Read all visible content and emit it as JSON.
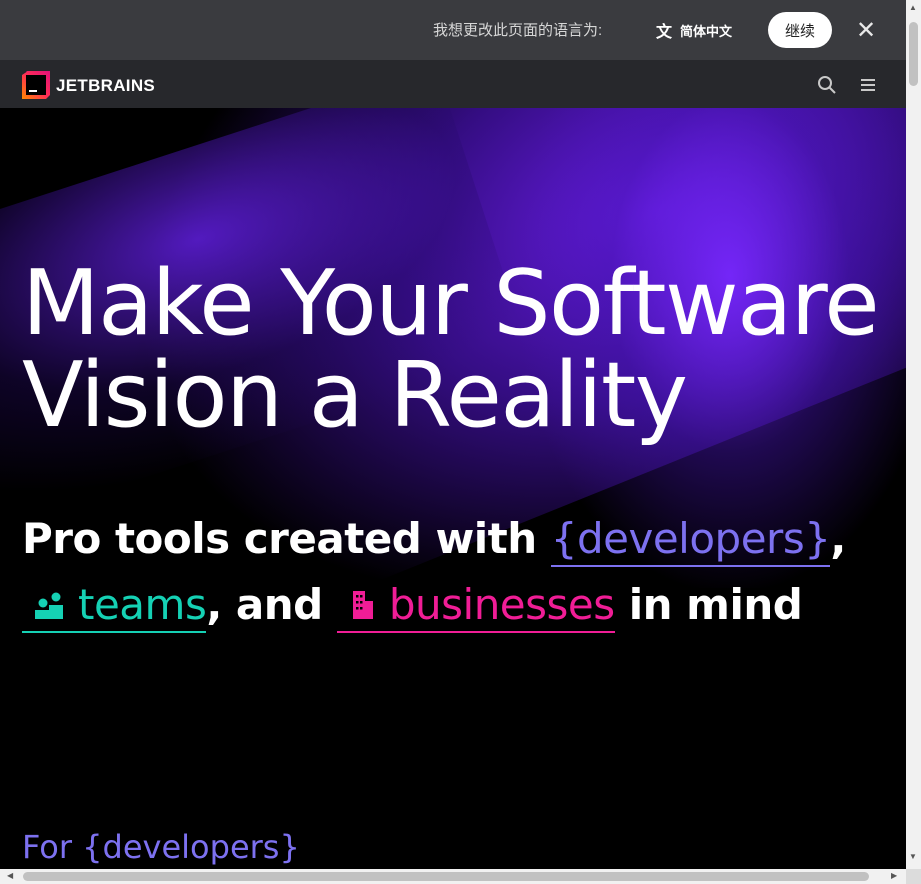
{
  "translate_bar": {
    "prompt": "我想更改此页面的语言为:",
    "language_label": "简体中文",
    "continue_label": "继续",
    "close_icon": "close-icon"
  },
  "header": {
    "logo_text": "JETBRAINS",
    "search_icon": "search-icon",
    "menu_icon": "hamburger-menu-icon"
  },
  "hero": {
    "headline_line1": "Make Your Software",
    "headline_line2": "Vision a Reality",
    "sub_prefix": "Pro tools created with ",
    "developers": "{developers}",
    "comma1": ",",
    "teams": "teams",
    "and_text": ", and ",
    "businesses": "businesses",
    "in_mind": " in mind",
    "for_developers": "For {developers}"
  },
  "colors": {
    "developers": "#7d71f0",
    "teams": "#15d1b4",
    "businesses": "#f01d96",
    "glow": "#6a1ff0"
  }
}
